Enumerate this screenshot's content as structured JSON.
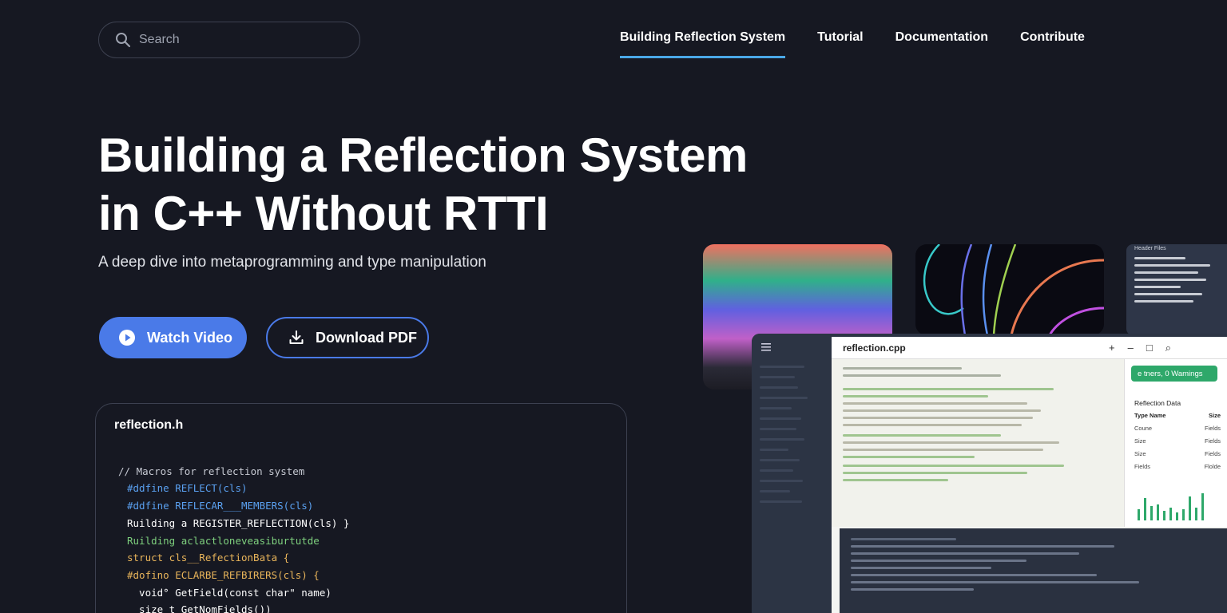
{
  "header": {
    "search_placeholder": "Search",
    "nav": [
      {
        "label": "Building Reflection System",
        "active": true
      },
      {
        "label": "Tutorial",
        "active": false
      },
      {
        "label": "Documentation",
        "active": false
      },
      {
        "label": "Contribute",
        "active": false
      }
    ]
  },
  "hero": {
    "title_line1": "Building a Reflection System",
    "title_line2": "in C++ Without RTTI",
    "subtitle": "A deep dive into metaprogramming and type manipulation",
    "watch_label": "Watch Video",
    "download_label": "Download PDF"
  },
  "code_card": {
    "filename": "reflection.h",
    "lines": [
      "// Macros for reflection system",
      "#ddfine REFLECT(cls)",
      "#ddfine REFLECAR___MEMBERS(cls)",
      "Ruilding a REGISTER_REFLECTION(cls) }",
      "Ruilding aclactloneveasiburtutde",
      "struct cls__RefectionBata {",
      "#dofino ECLARBE_REFBIRERS(cls) {",
      "  void° GetField(const char\" name)",
      "  size_t GetNomFields())"
    ]
  },
  "ide": {
    "filename": "reflection.cpp",
    "badge": "e tners, 0 Wamings",
    "panel_title": "Reflection Data",
    "panel_header": [
      "Type Name",
      "Size"
    ],
    "panel_rows": [
      [
        "Coune",
        "Fields"
      ],
      [
        "Size",
        "Fields"
      ],
      [
        "Size",
        "Fields"
      ],
      [
        "Fields",
        "Flolde"
      ]
    ],
    "top_thumb_title": "Header Files"
  },
  "colors": {
    "background": "#161822",
    "accent": "#4a7ae8",
    "nav_underline": "#4aa8e8"
  }
}
